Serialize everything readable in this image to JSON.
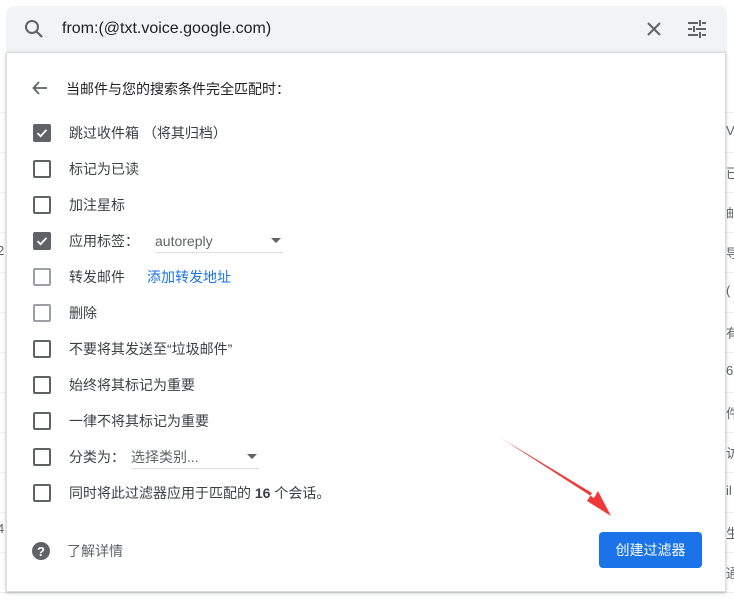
{
  "search": {
    "query": "from:(@txt.voice.google.com)",
    "clear_icon": "close-icon",
    "options_icon": "tune-icon"
  },
  "panel": {
    "header": "当邮件与您的搜索条件完全匹配时：",
    "options": [
      {
        "label": "跳过收件箱 （将其归档）",
        "checked": true
      },
      {
        "label": "标记为已读",
        "checked": false
      },
      {
        "label": "加注星标",
        "checked": false
      },
      {
        "label": "应用标签：",
        "checked": true,
        "select_value": "autoreply"
      },
      {
        "label": "转发邮件",
        "checked": false,
        "disabled": true,
        "link": "添加转发地址"
      },
      {
        "label": "删除",
        "checked": false,
        "disabled": true
      },
      {
        "label": "不要将其发送至“垃圾邮件”",
        "checked": false
      },
      {
        "label": "始终将其标记为重要",
        "checked": false
      },
      {
        "label": "一律不将其标记为重要",
        "checked": false
      },
      {
        "label": "分类为：",
        "checked": false,
        "select_value": "选择类别..."
      },
      {
        "label_pre": "同时将此过滤器应用于匹配的 ",
        "count": "16",
        "label_post": " 个会话。",
        "checked": false
      }
    ],
    "learn_more": "了解详情",
    "create_button": "创建过滤器"
  },
  "background_fragments": {
    "right": [
      "Vi",
      "已",
      "邮",
      "导",
      "(",
      "有",
      "6",
      "件",
      "访",
      "il",
      "生",
      "通"
    ],
    "left": [
      "2",
      "4"
    ]
  },
  "colors": {
    "accent": "#1a73e8",
    "annotation_arrow": "#f03a3a",
    "search_bg": "#f1f3f4"
  }
}
